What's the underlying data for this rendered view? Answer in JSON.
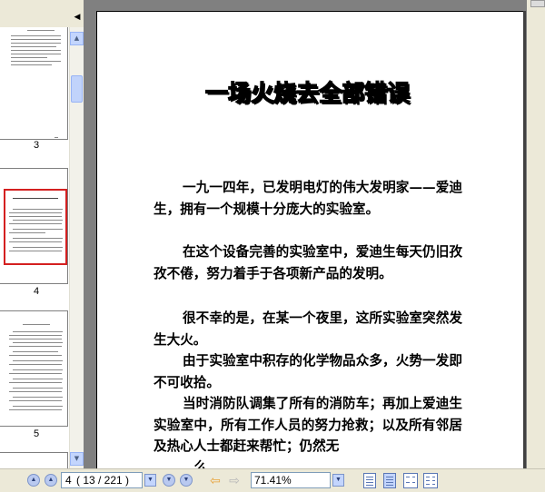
{
  "sidebar": {
    "collapse_icon": "collapse-left-arrow-icon",
    "thumbnails": [
      {
        "label": "3",
        "selected": false
      },
      {
        "label": "4",
        "selected": true
      },
      {
        "label": "5",
        "selected": false
      }
    ]
  },
  "document": {
    "title": "一场火烧去全部错误",
    "paragraphs": [
      "一九一四年，已发明电灯的伟大发明家——爱迪生，拥有一个规模十分庞大的实验室。",
      "在这个设备完善的实验室中，爱迪生每天仍旧孜孜不倦，努力着手于各项新产品的发明。",
      "很不幸的是，在某一个夜里，这所实验室突然发生大火。",
      "由于实验室中积存的化学物品众多，火势一发即不可收拾。",
      "当时消防队调集了所有的消防车；再加上爱迪生实验室中，所有工作人员的努力抢救；以及所有邻居及热心人士都赶来帮忙；仍然无",
      "…么…"
    ]
  },
  "statusbar": {
    "current_page": "4",
    "page_of": "( 13 / 221 )",
    "zoom": "71.41%",
    "accent_color": "#e8a33b"
  }
}
